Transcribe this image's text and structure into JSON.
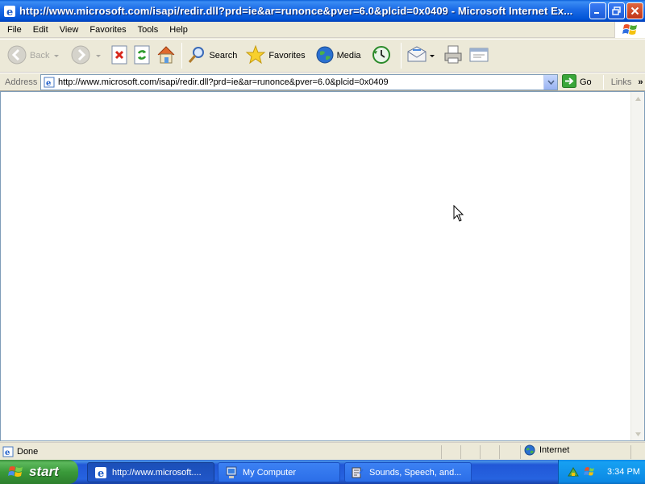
{
  "window": {
    "title": "http://www.microsoft.com/isapi/redir.dll?prd=ie&ar=runonce&pver=6.0&plcid=0x0409 - Microsoft Internet Ex..."
  },
  "menu": [
    "File",
    "Edit",
    "View",
    "Favorites",
    "Tools",
    "Help"
  ],
  "toolbar": {
    "back": "Back",
    "search": "Search",
    "favorites": "Favorites",
    "media": "Media"
  },
  "address": {
    "label": "Address",
    "url": "http://www.microsoft.com/isapi/redir.dll?prd=ie&ar=runonce&pver=6.0&plcid=0x0409",
    "go": "Go",
    "links": "Links"
  },
  "status": {
    "text": "Done",
    "zone": "Internet"
  },
  "taskbar": {
    "start": "start",
    "tasks": [
      {
        "label": "http://www.microsoft...."
      },
      {
        "label": "My Computer"
      },
      {
        "label": "Sounds, Speech, and..."
      }
    ],
    "clock": "3:34 PM"
  },
  "icons": {
    "ie": "ie-icon",
    "back": "back-arrow-icon",
    "forward": "forward-arrow-icon",
    "stop": "stop-icon",
    "refresh": "refresh-icon",
    "home": "home-icon",
    "search": "search-icon",
    "favorites": "star-icon",
    "media": "media-globe-icon",
    "history": "history-icon",
    "mail": "mail-icon",
    "print": "print-icon",
    "edit": "edit-icon"
  }
}
